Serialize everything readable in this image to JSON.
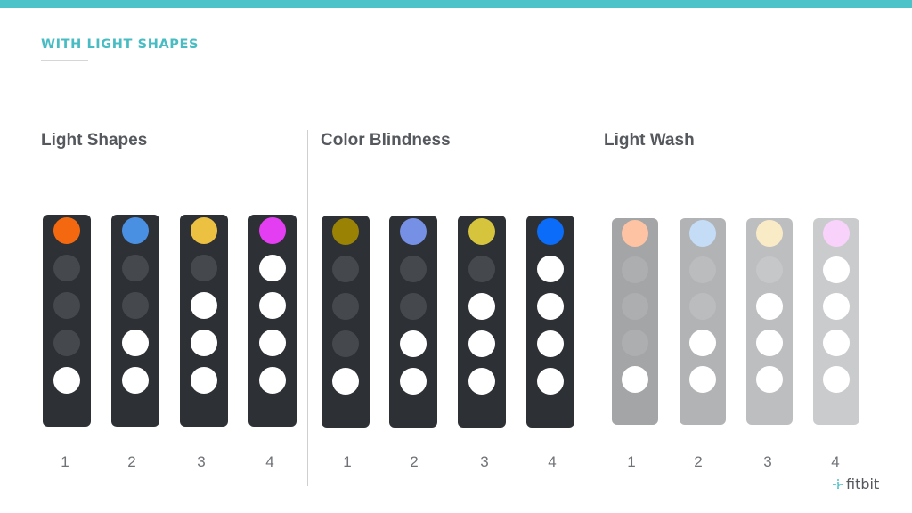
{
  "header": {
    "kicker": "WITH LIGHT SHAPES",
    "accent_color": "#4cc2c9"
  },
  "colors": {
    "device_dark": "#2d3035",
    "dot_off_dark": "#45484d",
    "dot_on": "#ffffff"
  },
  "sections": [
    {
      "title": "Light Shapes",
      "style": "dark",
      "devices": [
        {
          "label": "1",
          "accent": "#f4690f",
          "white_dots": 1
        },
        {
          "label": "2",
          "accent": "#4a90e2",
          "white_dots": 2
        },
        {
          "label": "3",
          "accent": "#ecc040",
          "white_dots": 3
        },
        {
          "label": "4",
          "accent": "#e43ef2",
          "white_dots": 4
        }
      ]
    },
    {
      "title": "Color Blindness",
      "style": "dark",
      "devices": [
        {
          "label": "1",
          "accent": "#9a8205",
          "white_dots": 1
        },
        {
          "label": "2",
          "accent": "#7690e6",
          "white_dots": 2
        },
        {
          "label": "3",
          "accent": "#d6c43c",
          "white_dots": 3
        },
        {
          "label": "4",
          "accent": "#0a6cf8",
          "white_dots": 4
        }
      ]
    },
    {
      "title": "Light Wash",
      "style": "wash",
      "devices": [
        {
          "label": "1",
          "accent": "#fdc3a2",
          "white_dots": 1,
          "body": "#a4a5a7",
          "off": "#adaeb0"
        },
        {
          "label": "2",
          "accent": "#c4dcf6",
          "white_dots": 2,
          "body": "#b2b3b5",
          "off": "#bbbcbe"
        },
        {
          "label": "3",
          "accent": "#f9ebc6",
          "white_dots": 3,
          "body": "#bdbec0",
          "off": "#c6c7c9"
        },
        {
          "label": "4",
          "accent": "#f8d2fa",
          "white_dots": 4,
          "body": "#cacbcd",
          "off": "#d2d3d5"
        }
      ]
    }
  ],
  "brand": {
    "name": "fitbit",
    "icon": "fitbit-dots-logo-icon"
  }
}
